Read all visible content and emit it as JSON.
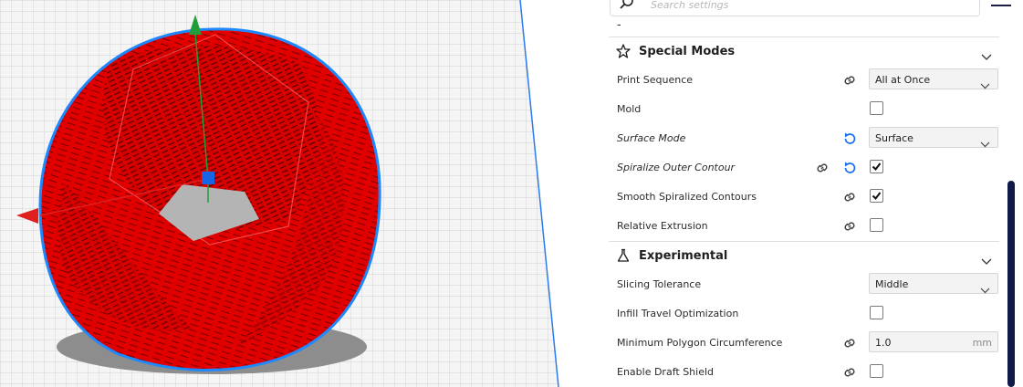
{
  "search": {
    "placeholder": "Search settings"
  },
  "header": {
    "dash": "-"
  },
  "categories": {
    "special_modes": {
      "label": "Special Modes"
    },
    "experimental": {
      "label": "Experimental"
    }
  },
  "settings": {
    "print_sequence": {
      "label": "Print Sequence",
      "value": "All at Once"
    },
    "mold": {
      "label": "Mold",
      "checked": false
    },
    "surface_mode": {
      "label": "Surface Mode",
      "value": "Surface"
    },
    "spiralize_outer_contour": {
      "label": "Spiralize Outer Contour",
      "checked": true
    },
    "smooth_spiralized_contours": {
      "label": "Smooth Spiralized Contours",
      "checked": true
    },
    "relative_extrusion": {
      "label": "Relative Extrusion",
      "checked": false
    },
    "slicing_tolerance": {
      "label": "Slicing Tolerance",
      "value": "Middle"
    },
    "infill_travel_optimization": {
      "label": "Infill Travel Optimization",
      "checked": false
    },
    "minimum_polygon_circumference": {
      "label": "Minimum Polygon Circumference",
      "value": "1.0",
      "unit": "mm"
    },
    "enable_draft_shield": {
      "label": "Enable Draft Shield",
      "checked": false
    }
  },
  "colors": {
    "accent": "#196ef0",
    "model_red": "#e00000",
    "scrollbar": "#101a4a"
  },
  "icons": [
    "search-icon",
    "menu-icon",
    "star-icon",
    "flask-icon",
    "chevron-down-icon",
    "link-icon",
    "reset-icon",
    "check-icon"
  ]
}
